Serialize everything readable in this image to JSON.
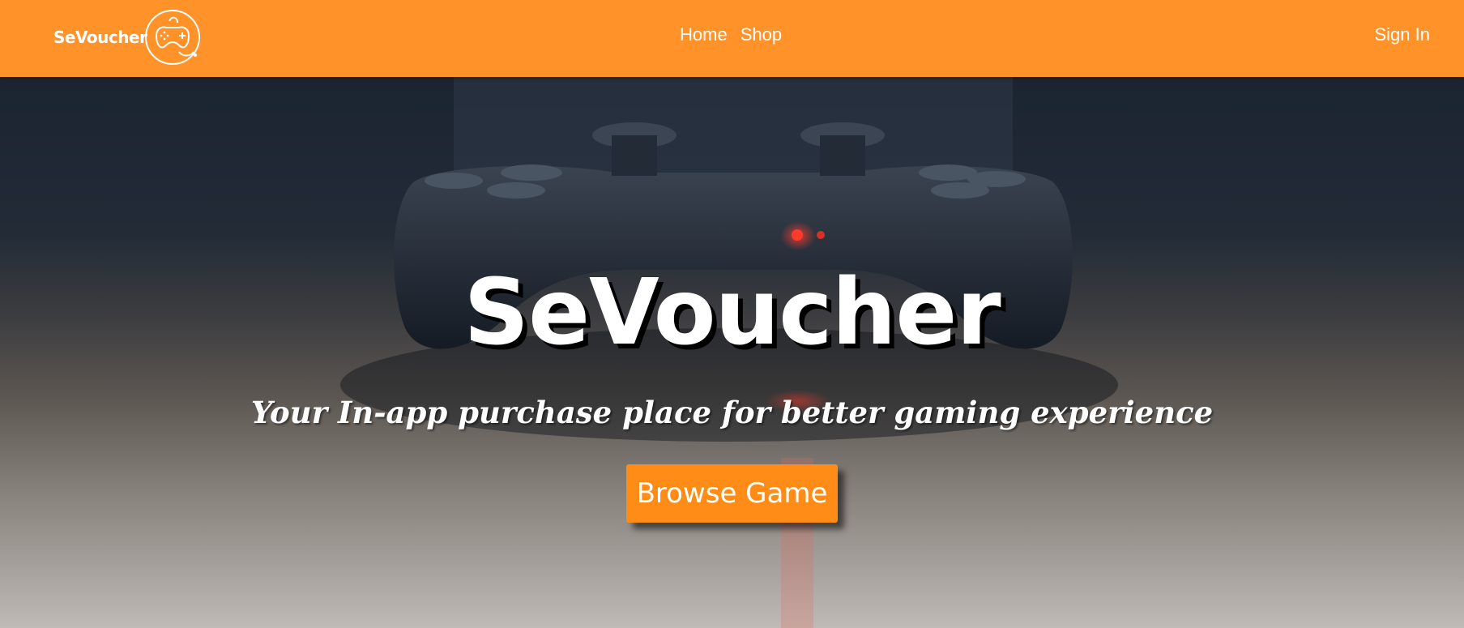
{
  "navbar": {
    "brand": "SeVoucher",
    "logo_icon": "gamepad-icon",
    "links": [
      {
        "label": "Home"
      },
      {
        "label": "Shop"
      }
    ],
    "signin_label": "Sign In",
    "color": "#ff9229"
  },
  "hero": {
    "title": "SeVoucher",
    "subtitle": "Your In-app purchase place for better gaming experience",
    "button_label": "Browse Game",
    "button_color": "#ff8c16",
    "background_image": "game-controller-photo"
  }
}
